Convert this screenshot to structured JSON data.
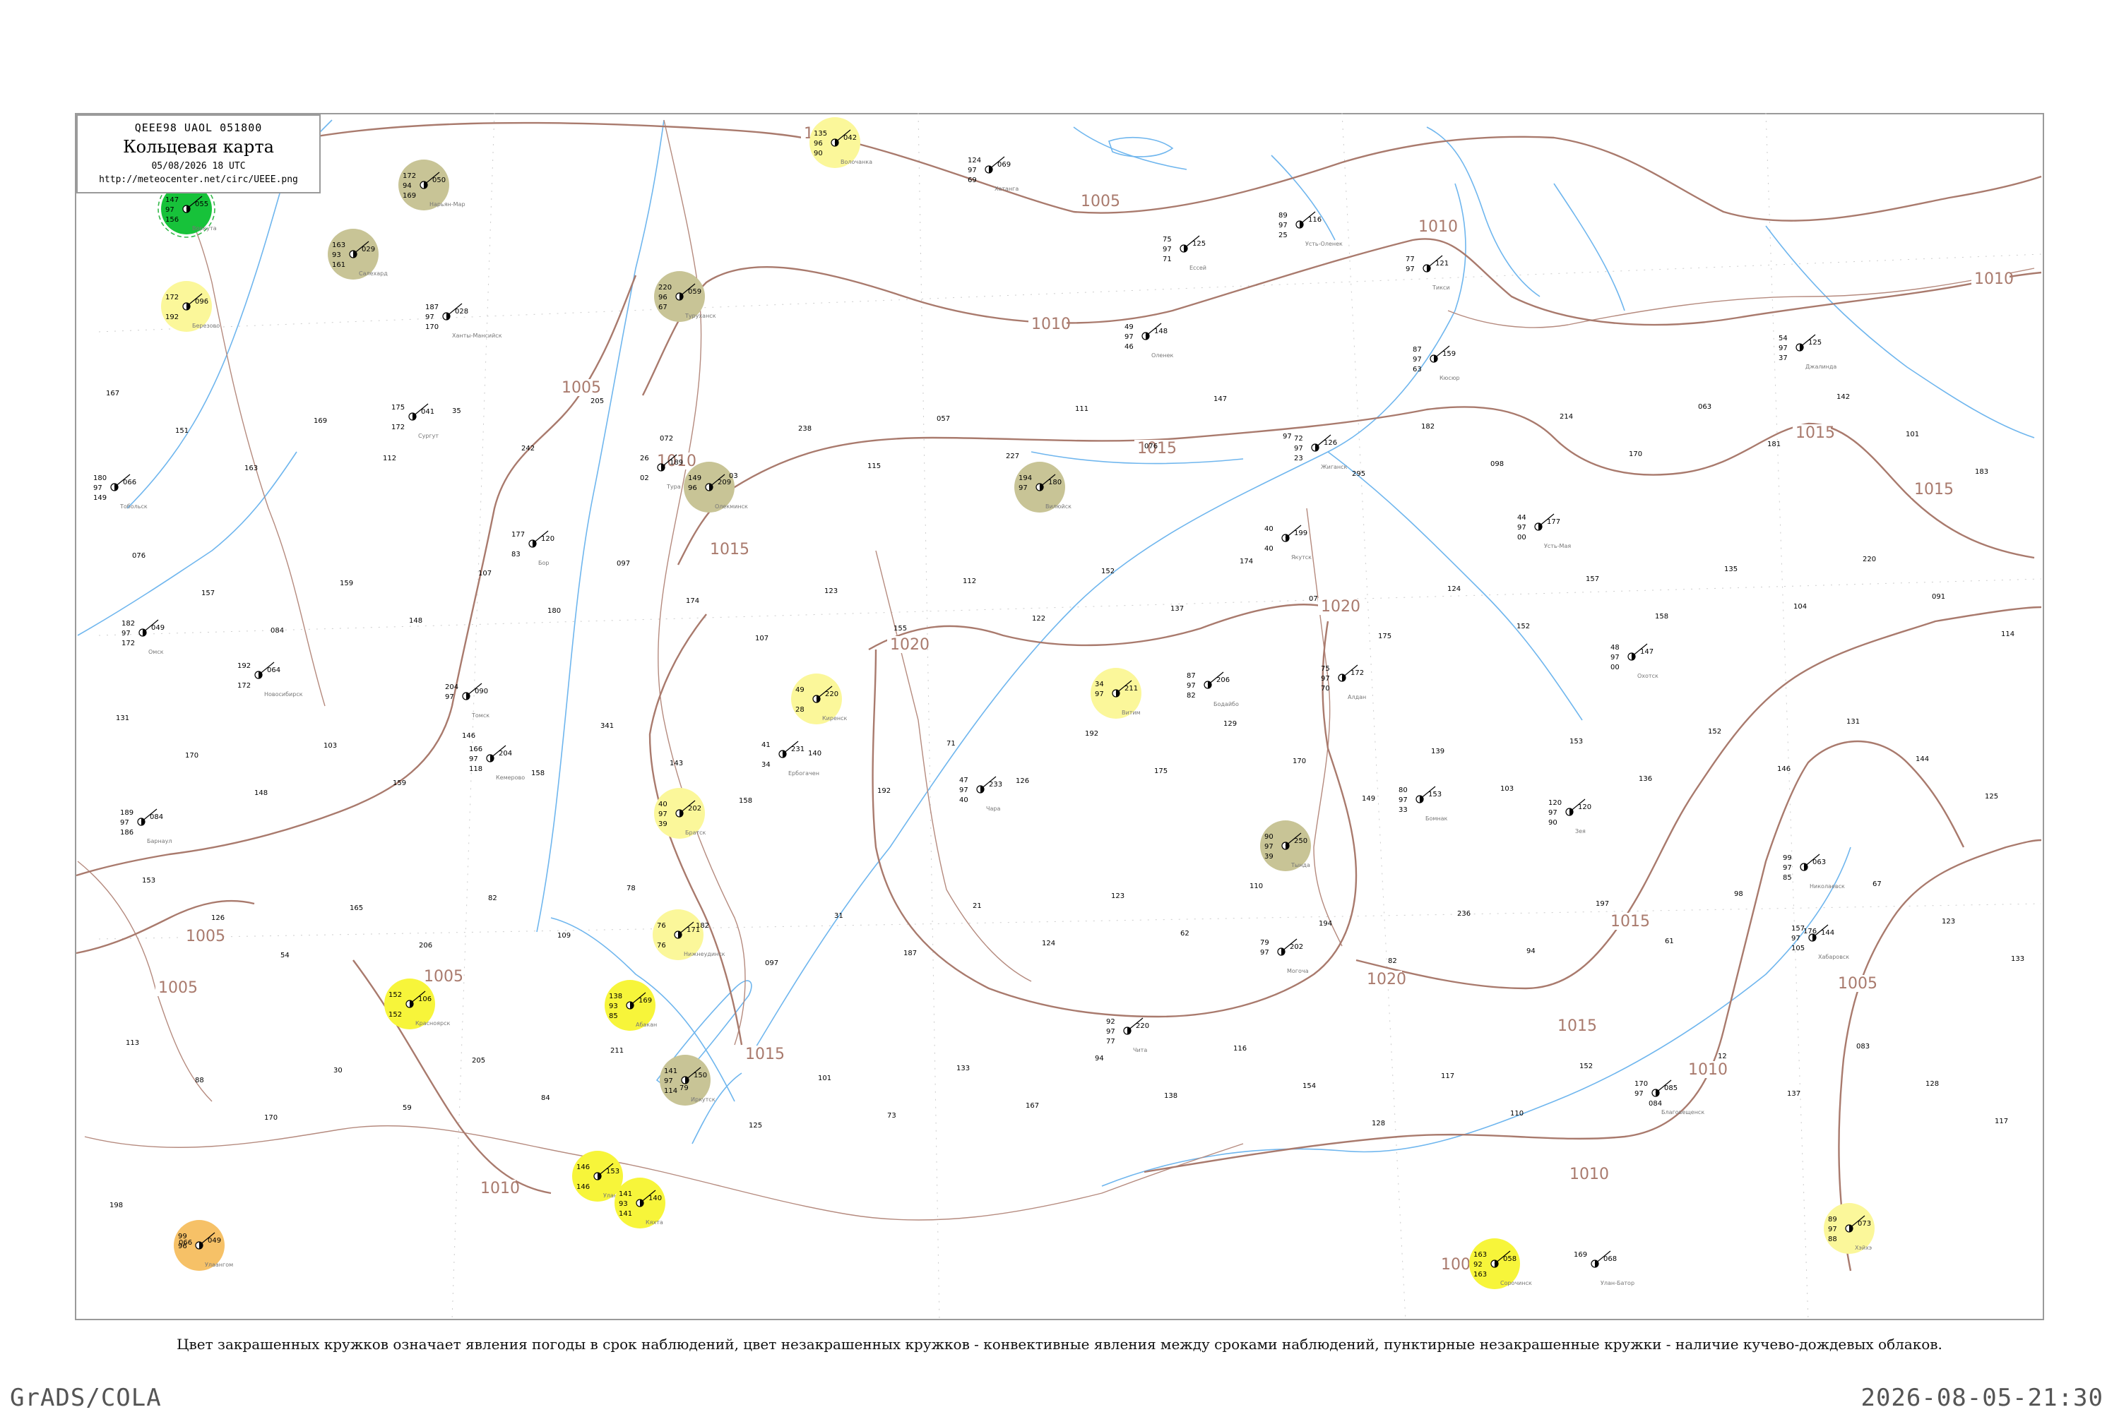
{
  "legend": {
    "code": "QEEE98  UAOL  051800",
    "title": "Кольцевая карта",
    "date": "05/08/2026 18 UTC",
    "url": "http://meteocenter.net/circ/UEEE.png"
  },
  "footnote": "Цвет закрашенных кружков означает явления погоды в срок наблюдений, цвет незакрашенных кружков - конвективные явления между сроками наблюдений, пунктирные незакрашенные кружки - наличие кучево-дождевых облаков.",
  "footer": {
    "left": "GrADS/COLA",
    "right": "2026-08-05-21:30"
  },
  "colors": {
    "isobar": "#a97a6d",
    "water": "#6fb6ee",
    "frame": "#9a9a9a",
    "fill_green": "#17c23a",
    "fill_red": "#f0365f",
    "fill_khaki": "#c8c496",
    "fill_yellow": "#f7f53a",
    "fill_pale_yellow": "#fbf79a",
    "fill_orange": "#f6c167",
    "ring_green": "#35b84a",
    "ring_red": "#e0475f"
  },
  "isobar_labels": [
    "1000",
    "1005",
    "1005",
    "1005",
    "1010",
    "1010",
    "1010",
    "1010",
    "1010",
    "1015",
    "1015",
    "1015",
    "1015",
    "1015",
    "1015",
    "1020",
    "1020",
    "1020",
    "1005",
    "1005",
    "1005",
    "1010",
    "1015",
    "1005",
    "1010"
  ],
  "stations": [
    {
      "name": "Усть-Оленек",
      "top": "89",
      "mid": "97",
      "bot": "25",
      "right": "116",
      "style": "plain"
    },
    {
      "name": "Тикси",
      "top": "77",
      "mid": "97",
      "bot": "",
      "right": "121",
      "style": "plain"
    },
    {
      "name": "Кюсюр",
      "top": "87",
      "mid": "97",
      "bot": "63",
      "right": "159",
      "style": "plain"
    },
    {
      "name": "Джалинда",
      "top": "54",
      "mid": "97",
      "bot": "37",
      "right": "125",
      "style": "plain"
    },
    {
      "name": "Хатанга",
      "top": "124",
      "mid": "97",
      "bot": "69",
      "right": "069",
      "style": "plain"
    },
    {
      "name": "Волочанка",
      "top": "135",
      "mid": "96",
      "bot": "90",
      "right": "042",
      "style": "pale_yellow"
    },
    {
      "name": "Ессей",
      "top": "75",
      "mid": "97",
      "bot": "71",
      "right": "125",
      "style": "plain"
    },
    {
      "name": "Туруханск",
      "top": "220",
      "mid": "96",
      "bot": "67",
      "right": "059",
      "style": "khaki"
    },
    {
      "name": "Жиганск",
      "top": "72",
      "mid": "97",
      "bot": "23",
      "right": "126",
      "style": "plain"
    },
    {
      "name": "Оленек",
      "top": "49",
      "mid": "97",
      "bot": "46",
      "right": "148",
      "style": "plain"
    },
    {
      "name": "Вилюйск",
      "top": "194",
      "mid": "97",
      "bot": "",
      "right": "180",
      "style": "khaki"
    },
    {
      "name": "Якутск",
      "top": "40",
      "mid": "",
      "bot": "40",
      "right": "199",
      "style": "plain"
    },
    {
      "name": "Усть-Мая",
      "top": "44",
      "mid": "97",
      "bot": "00",
      "right": "177",
      "style": "plain"
    },
    {
      "name": "Олекминск",
      "top": "149",
      "mid": "96",
      "bot": "",
      "right": "209",
      "style": "khaki"
    },
    {
      "name": "Витим",
      "top": "34",
      "mid": "97",
      "bot": "",
      "right": "211",
      "style": "pale_yellow"
    },
    {
      "name": "Киренск",
      "top": "49",
      "mid": "",
      "bot": "28",
      "right": "220",
      "style": "pale_yellow"
    },
    {
      "name": "Бодайбо",
      "top": "87",
      "mid": "97",
      "bot": "82",
      "right": "206",
      "style": "plain"
    },
    {
      "name": "Алдан",
      "top": "75",
      "mid": "97",
      "bot": "70",
      "right": "172",
      "style": "plain"
    },
    {
      "name": "Охотск",
      "top": "48",
      "mid": "97",
      "bot": "00",
      "right": "147",
      "style": "plain"
    },
    {
      "name": "Чара",
      "top": "47",
      "mid": "97",
      "bot": "40",
      "right": "233",
      "style": "plain"
    },
    {
      "name": "Тында",
      "top": "90",
      "mid": "97",
      "bot": "39",
      "right": "250",
      "style": "khaki"
    },
    {
      "name": "Бомнак",
      "top": "80",
      "mid": "97",
      "bot": "33",
      "right": "153",
      "style": "plain"
    },
    {
      "name": "Зея",
      "top": "120",
      "mid": "97",
      "bot": "90",
      "right": "120",
      "style": "plain"
    },
    {
      "name": "Братск",
      "top": "40",
      "mid": "97",
      "bot": "39",
      "right": "202",
      "style": "pale_yellow"
    },
    {
      "name": "Ербогачен",
      "top": "41",
      "mid": "",
      "bot": "34",
      "right": "231",
      "style": "plain"
    },
    {
      "name": "Нижнеудинск",
      "top": "76",
      "mid": "",
      "bot": "76",
      "right": "171",
      "style": "pale_yellow"
    },
    {
      "name": "Иркутск",
      "top": "141",
      "mid": "97",
      "bot": "114",
      "right": "150",
      "style": "khaki"
    },
    {
      "name": "Чита",
      "top": "92",
      "mid": "97",
      "bot": "77",
      "right": "220",
      "style": "plain"
    },
    {
      "name": "Могоча",
      "top": "79",
      "mid": "97",
      "bot": "",
      "right": "202",
      "style": "plain"
    },
    {
      "name": "Благовещенск",
      "top": "170",
      "mid": "97",
      "bot": "",
      "right": "085",
      "style": "plain"
    },
    {
      "name": "Хабаровск",
      "top": "157",
      "mid": "97",
      "bot": "105",
      "right": "144",
      "style": "plain"
    },
    {
      "name": "Николаевск",
      "top": "99",
      "mid": "97",
      "bot": "85",
      "right": "063",
      "style": "plain"
    },
    {
      "name": "Улан-Удэ",
      "top": "146",
      "mid": "",
      "bot": "146",
      "right": "153",
      "style": "yellow"
    },
    {
      "name": "Кяхта",
      "top": "141",
      "mid": "93",
      "bot": "141",
      "right": "140",
      "style": "yellow"
    },
    {
      "name": "Красноярск",
      "top": "152",
      "mid": "",
      "bot": "152",
      "right": "106",
      "style": "yellow"
    },
    {
      "name": "Абакан",
      "top": "138",
      "mid": "93",
      "bot": "85",
      "right": "169",
      "style": "yellow"
    },
    {
      "name": "Улан-Батор",
      "top": "169",
      "mid": "",
      "bot": "",
      "right": "068",
      "style": "plain"
    },
    {
      "name": "Улаангом",
      "top": "99",
      "mid": "96",
      "bot": "",
      "right": "049",
      "style": "orange"
    },
    {
      "name": "Сорочинск",
      "top": "163",
      "mid": "92",
      "bot": "163",
      "right": "058",
      "style": "yellow"
    },
    {
      "name": "Хэйхэ",
      "top": "89",
      "mid": "97",
      "bot": "88",
      "right": "073",
      "style": "pale_yellow"
    },
    {
      "name": "Нарьян-Мар",
      "top": "172",
      "mid": "94",
      "bot": "169",
      "right": "050",
      "style": "khaki"
    },
    {
      "name": "Салехард",
      "top": "163",
      "mid": "93",
      "bot": "161",
      "right": "029",
      "style": "khaki"
    },
    {
      "name": "Воркута",
      "top": "147",
      "mid": "97",
      "bot": "156",
      "right": "055",
      "style": "green"
    },
    {
      "name": "Березово",
      "top": "172",
      "mid": "",
      "bot": "192",
      "right": "096",
      "style": "pale_yellow"
    },
    {
      "name": "Ханты-Мансийск",
      "top": "187",
      "mid": "97",
      "bot": "170",
      "right": "028",
      "style": "plain"
    },
    {
      "name": "Сургут",
      "top": "175",
      "mid": "",
      "bot": "172",
      "right": "041",
      "style": "plain"
    },
    {
      "name": "Тобольск",
      "top": "180",
      "mid": "97",
      "bot": "149",
      "right": "066",
      "style": "plain"
    },
    {
      "name": "Омск",
      "top": "182",
      "mid": "97",
      "bot": "172",
      "right": "049",
      "style": "plain"
    },
    {
      "name": "Новосибирск",
      "top": "192",
      "mid": "",
      "bot": "172",
      "right": "064",
      "style": "plain"
    },
    {
      "name": "Барнаул",
      "top": "189",
      "mid": "97",
      "bot": "186",
      "right": "084",
      "style": "plain"
    },
    {
      "name": "Томск",
      "top": "204",
      "mid": "97",
      "bot": "",
      "right": "090",
      "style": "plain"
    },
    {
      "name": "Кемерово",
      "top": "166",
      "mid": "97",
      "bot": "118",
      "right": "204",
      "style": "plain"
    },
    {
      "name": "Тура",
      "top": "26",
      "mid": "",
      "bot": "02",
      "right": "189",
      "style": "plain"
    },
    {
      "name": "Бор",
      "top": "177",
      "mid": "",
      "bot": "83",
      "right": "120",
      "style": "plain"
    }
  ],
  "small_numbers": [
    "167",
    "151",
    "163",
    "169",
    "112",
    "35",
    "242",
    "205",
    "072",
    "03",
    "238",
    "115",
    "057",
    "227",
    "111",
    "076",
    "147",
    "97",
    "295",
    "182",
    "098",
    "214",
    "170",
    "063",
    "181",
    "142",
    "101",
    "183",
    "076",
    "157",
    "084",
    "159",
    "148",
    "107",
    "180",
    "097",
    "174",
    "107",
    "123",
    "155",
    "112",
    "122",
    "152",
    "137",
    "174",
    "07",
    "175",
    "124",
    "152",
    "157",
    "158",
    "135",
    "104",
    "220",
    "091",
    "114",
    "131",
    "170",
    "148",
    "103",
    "159",
    "146",
    "158",
    "341",
    "143",
    "158",
    "140",
    "192",
    "71",
    "126",
    "192",
    "175",
    "129",
    "170",
    "149",
    "139",
    "103",
    "153",
    "136",
    "152",
    "146",
    "131",
    "144",
    "125",
    "153",
    "126",
    "54",
    "165",
    "206",
    "82",
    "109",
    "78",
    "182",
    "097",
    "31",
    "187",
    "21",
    "124",
    "123",
    "62",
    "110",
    "194",
    "82",
    "236",
    "94",
    "197",
    "61",
    "98",
    "176",
    "67",
    "123",
    "133",
    "113",
    "88",
    "170",
    "30",
    "59",
    "205",
    "84",
    "211",
    "79",
    "125",
    "101",
    "73",
    "133",
    "167",
    "94",
    "138",
    "116",
    "154",
    "128",
    "117",
    "110",
    "152",
    "084",
    "12",
    "137",
    "083",
    "128",
    "117",
    "198",
    "066"
  ]
}
